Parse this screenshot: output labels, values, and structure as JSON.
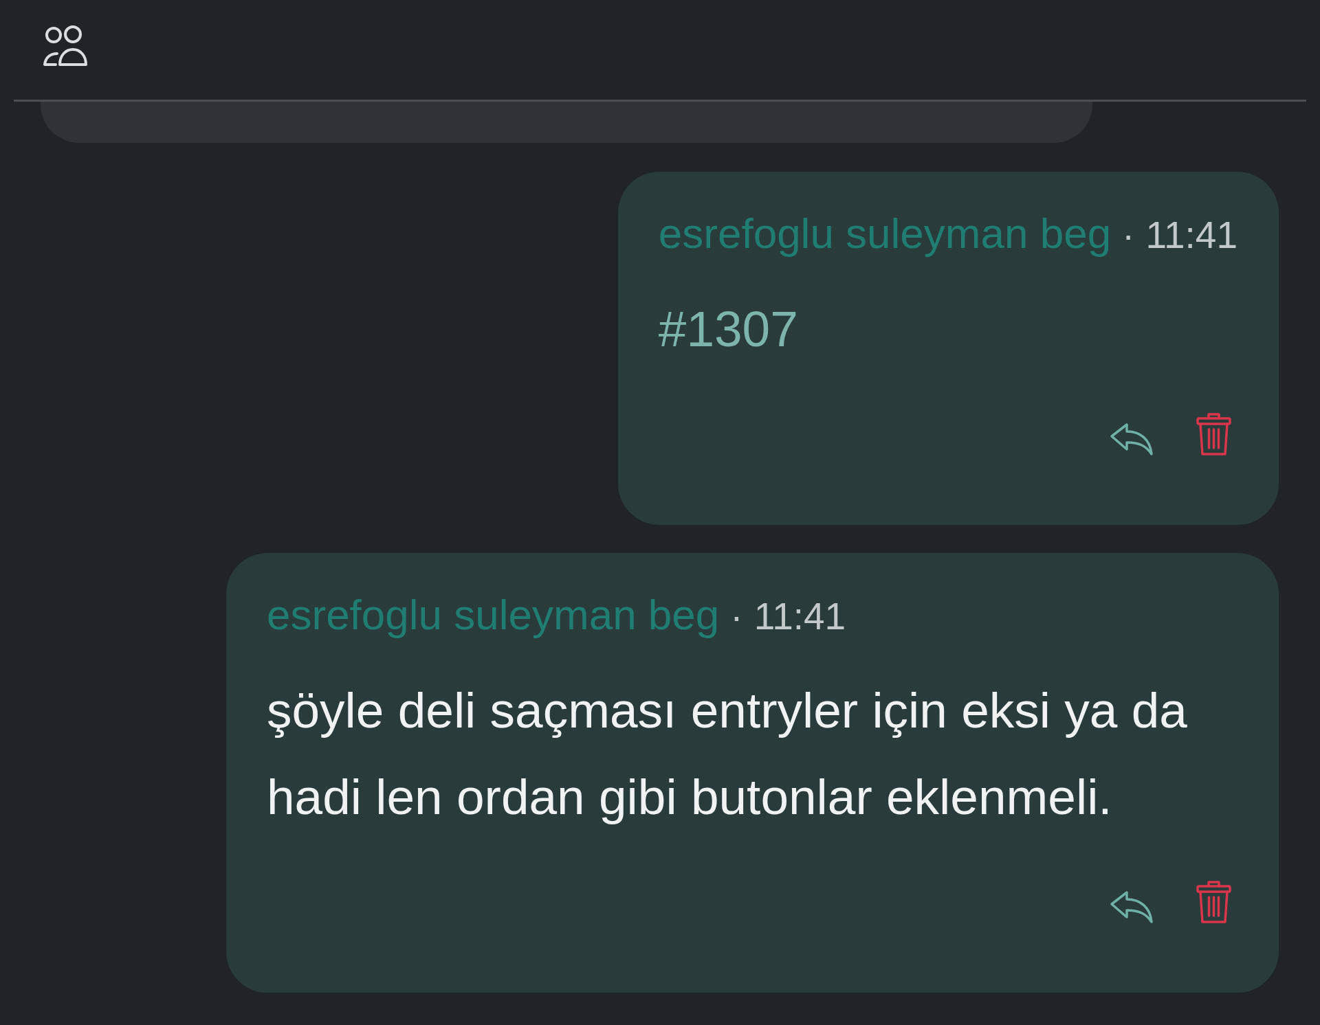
{
  "messages": [
    {
      "author": "esrefoglu suleyman beg",
      "separator": "·",
      "time": "11:41",
      "kind": "reference",
      "body": "#1307"
    },
    {
      "author": "esrefoglu suleyman beg",
      "separator": "·",
      "time": "11:41",
      "kind": "text",
      "body": "şöyle deli saçması entryler için eksi ya da hadi len ordan gibi butonlar eklenmeli."
    }
  ]
}
